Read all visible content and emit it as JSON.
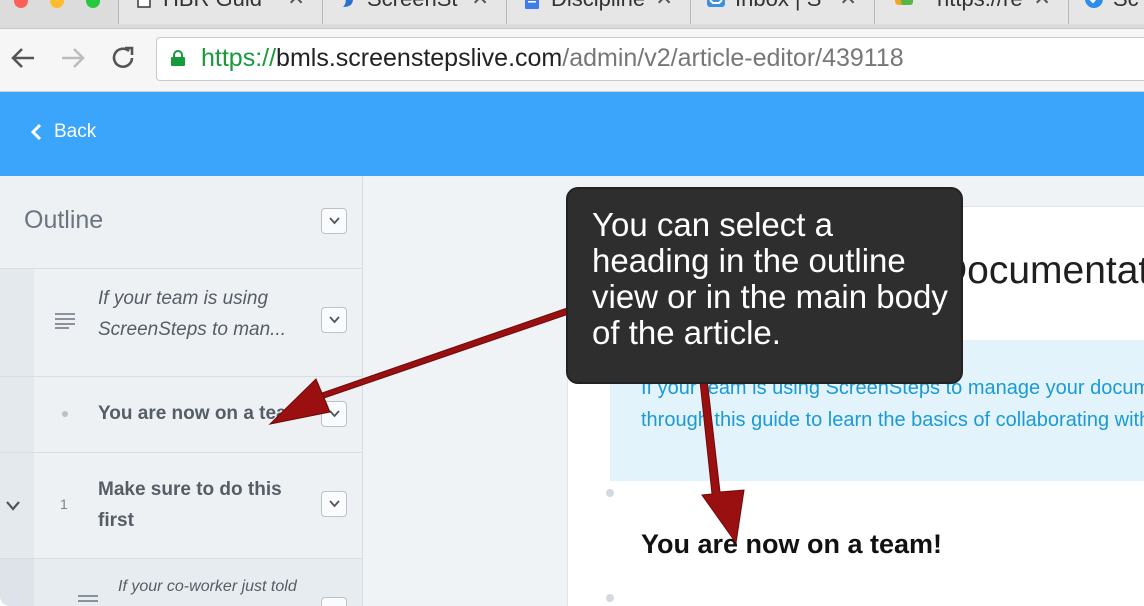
{
  "browser": {
    "tabs": [
      {
        "label": "HBR Guid",
        "icon": "document-icon"
      },
      {
        "label": "ScreenSt",
        "icon": "screensteps-icon"
      },
      {
        "label": "Discipline",
        "icon": "google-docs-icon"
      },
      {
        "label": "Inbox | S",
        "icon": "inbox-icon"
      },
      {
        "label": "https://re",
        "icon": "chat-icon"
      },
      {
        "label": "Sc",
        "icon": "app-icon"
      }
    ],
    "url": {
      "scheme": "https://",
      "host": "bmls.screenstepslive.com",
      "path": "/admin/v2/article-editor/439118"
    }
  },
  "header": {
    "back_label": "Back",
    "accent_color": "#3aa5fb"
  },
  "outline": {
    "title": "Outline",
    "items": [
      {
        "marker": "paragraph-icon",
        "line1": "If your team is using",
        "line2": "ScreenSteps to man..."
      },
      {
        "marker": "bullet-icon",
        "text": "You are now on a team!"
      },
      {
        "marker": "1",
        "line1": "Make sure to do this",
        "line2": "first"
      },
      {
        "marker": "paragraph-icon",
        "line1": "If your co-worker just told"
      }
    ]
  },
  "article": {
    "title": "Documentation",
    "callout_line1": "If your team is using ScreenSteps to manage your documentation,",
    "callout_line2": "through this guide to learn the basics of collaborating with",
    "heading": "You are now on a team!"
  },
  "annotation": {
    "text": "You can select a heading in the outline view or in the main body of the article.",
    "arrow_color": "#9a0f0f"
  }
}
